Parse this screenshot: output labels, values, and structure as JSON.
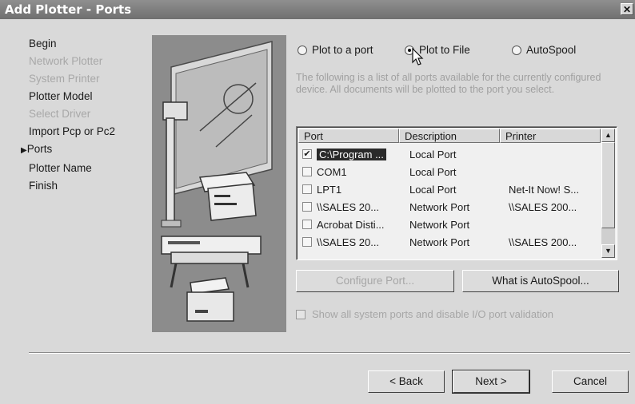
{
  "window": {
    "title": "Add Plotter - Ports",
    "close_glyph": "✕"
  },
  "steps": [
    {
      "label": "Begin",
      "state": "normal"
    },
    {
      "label": "Network Plotter",
      "state": "disabled"
    },
    {
      "label": "System Printer",
      "state": "disabled"
    },
    {
      "label": "Plotter Model",
      "state": "normal"
    },
    {
      "label": "Select Driver",
      "state": "disabled"
    },
    {
      "label": "Import Pcp or Pc2",
      "state": "normal"
    },
    {
      "label": "Ports",
      "state": "current",
      "marker": "▶"
    },
    {
      "label": "Plotter Name",
      "state": "normal"
    },
    {
      "label": "Finish",
      "state": "normal"
    }
  ],
  "options": {
    "plot_to_port": "Plot to a port",
    "plot_to_file": "Plot to File",
    "autospool": "AutoSpool",
    "selected": "plot_to_file"
  },
  "description": "The following is a list of all ports available for the currently configured device. All documents will be plotted to the port you select.",
  "ports_table": {
    "columns": [
      "Port",
      "Description",
      "Printer"
    ],
    "rows": [
      {
        "port": "C:\\Program ...",
        "description": "Local Port",
        "printer": "",
        "checked": true,
        "selected": true
      },
      {
        "port": "COM1",
        "description": "Local Port",
        "printer": "",
        "checked": false,
        "selected": false
      },
      {
        "port": "LPT1",
        "description": "Local Port",
        "printer": "Net-It Now! S...",
        "checked": false,
        "selected": false
      },
      {
        "port": "\\\\SALES 20...",
        "description": "Network Port",
        "printer": "\\\\SALES 200...",
        "checked": false,
        "selected": false
      },
      {
        "port": "Acrobat Disti...",
        "description": "Network Port",
        "printer": "",
        "checked": false,
        "selected": false
      },
      {
        "port": "\\\\SALES 20...",
        "description": "Network Port",
        "printer": "\\\\SALES 200...",
        "checked": false,
        "selected": false
      }
    ],
    "scroll_up": "▲",
    "scroll_down": "▼"
  },
  "buttons": {
    "configure_port": "Configure Port...",
    "what_is_autospool": "What is AutoSpool...",
    "back": "< Back",
    "next": "Next >",
    "cancel": "Cancel"
  },
  "show_all_ports": "Show all system ports and disable I/O port validation",
  "icons": {
    "check": "✔",
    "radio": "radio-icon",
    "cursor": "mouse-cursor-icon"
  }
}
